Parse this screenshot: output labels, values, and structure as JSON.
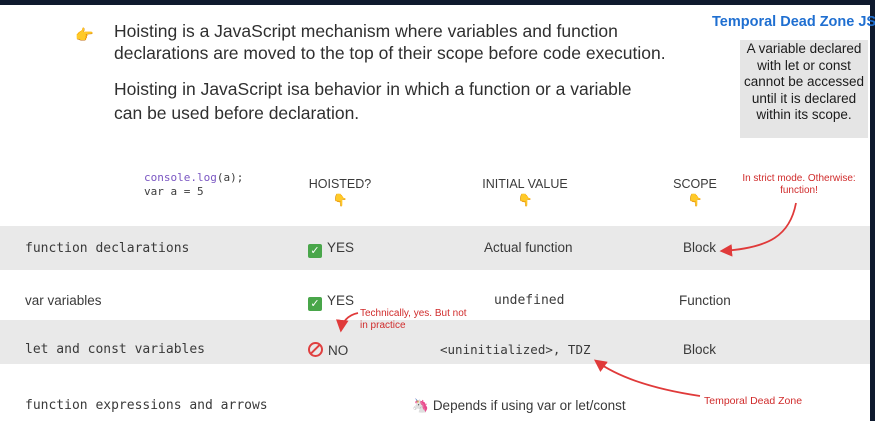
{
  "bullets": [
    "Hoisting is a JavaScript mechanism where variables and function declarations are moved to the top of their scope before code execution.",
    "Hoisting in JavaScript isa behavior in which a function or a variable can be used before declaration."
  ],
  "sidebar": {
    "title": "Temporal Dead Zone JS?",
    "text": "A variable declared with let or const cannot be accessed until it is declared within its scope."
  },
  "code": {
    "line1_fn": "console.log",
    "line1_arg": "(a);",
    "line2": "var a = 5"
  },
  "headers": {
    "hoisted": "HOISTED?",
    "initial": "INITIAL VALUE",
    "scope": "SCOPE"
  },
  "icons": {
    "bullet": "pointing-hand-icon",
    "header": "pointing-down-icon",
    "yes": "checkmark-icon",
    "no": "prohibited-icon",
    "depends": "unicorn-icon"
  },
  "rows": [
    {
      "label": "function declarations",
      "hoisted": "YES",
      "initial": "Actual function",
      "scope": "Block"
    },
    {
      "label": "var variables",
      "hoisted": "YES",
      "initial": "undefined",
      "scope": "Function"
    },
    {
      "label": "let and const variables",
      "hoisted": "NO",
      "initial": "<uninitialized>, TDZ",
      "scope": "Block"
    },
    {
      "label": "function expressions and arrows",
      "depends": "Depends if using var or let/const"
    }
  ],
  "annotations": {
    "strict": "In strict mode. Otherwise: function!",
    "technically": "Technically, yes. But not in practice",
    "tdz": "Temporal Dead Zone"
  },
  "colors": {
    "accent_blue": "#1f6fd1",
    "annotation_red": "#d02b2b",
    "band": "#e9e9e9",
    "check_green": "#49a64a",
    "frame": "#0f1a2e"
  }
}
